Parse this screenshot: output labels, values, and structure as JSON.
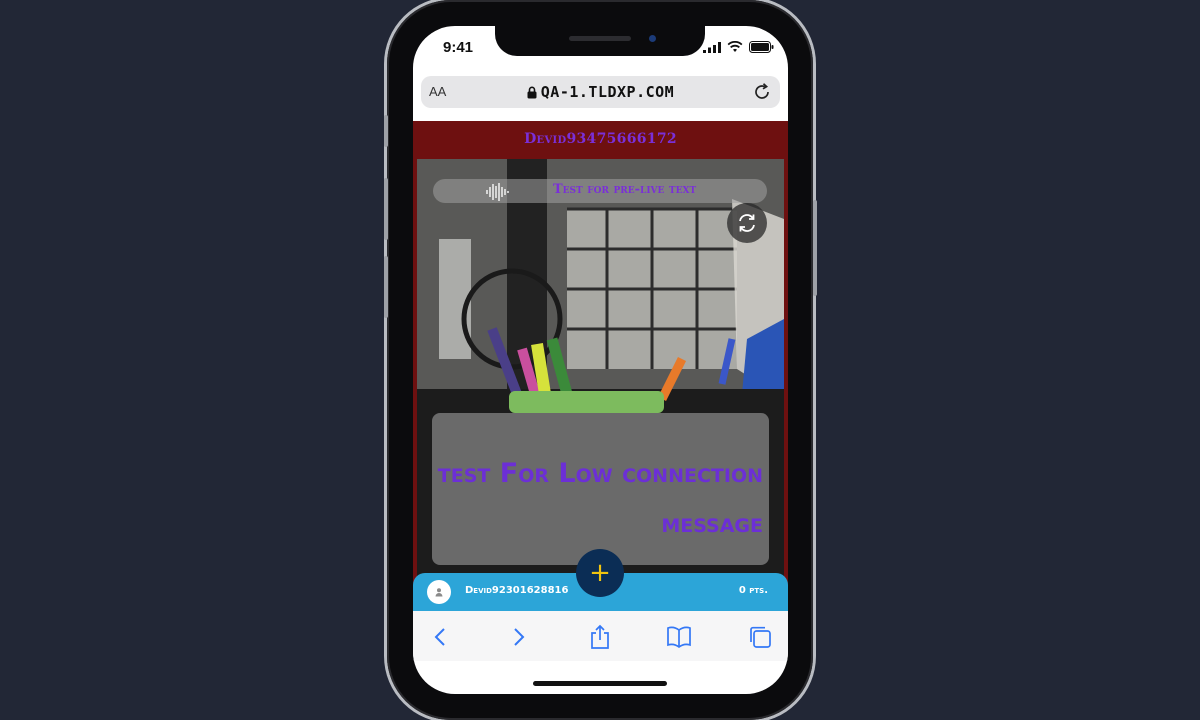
{
  "status_bar": {
    "time": "9:41"
  },
  "browser": {
    "text_size_label": "AA",
    "url": "QA-1.TLDXP.COM"
  },
  "page": {
    "header_username": "Devid93475666172",
    "audio_banner_text": "Test for pre-live text",
    "message_text": "test For Low connection message",
    "bottom_bar": {
      "username": "Devid92301628816",
      "points": "0 pts."
    },
    "fab_label": "+"
  },
  "colors": {
    "header_bg": "#6e1010",
    "accent_purple": "#7a2fd8",
    "bottom_bar_bg": "#2ca5d8",
    "fab_bg": "#0b2d55",
    "fab_plus": "#f1c40f",
    "safari_blue": "#3478f6"
  },
  "icons": [
    "lock-icon",
    "reload-icon",
    "audio-wave-icon",
    "switch-camera-icon",
    "user-icon",
    "back-icon",
    "forward-icon",
    "share-icon",
    "bookmarks-icon",
    "tabs-icon"
  ]
}
